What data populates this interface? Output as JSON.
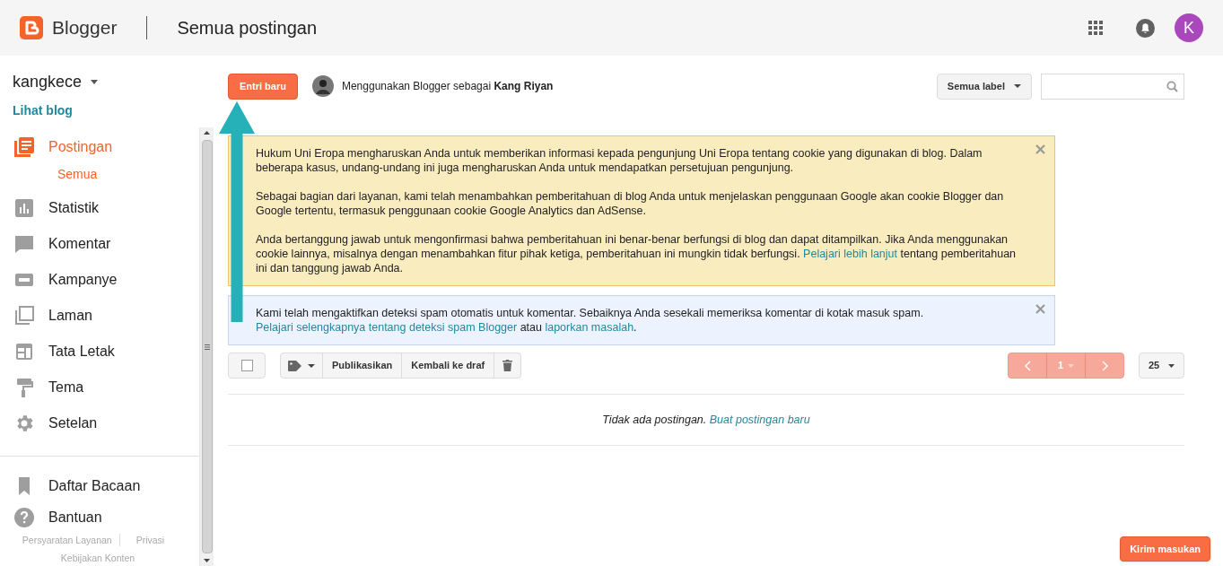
{
  "header": {
    "logo": "Blogger",
    "title": "Semua postingan",
    "avatar": "K"
  },
  "sidebar": {
    "blog": "kangkece",
    "view_blog": "Lihat blog",
    "items": [
      {
        "label": "Postingan",
        "selected": true,
        "children": [
          {
            "label": "Semua",
            "selected": true
          }
        ]
      },
      {
        "label": "Statistik",
        "selected": false
      },
      {
        "label": "Komentar",
        "selected": false
      },
      {
        "label": "Kampanye",
        "selected": false
      },
      {
        "label": "Laman",
        "selected": false
      },
      {
        "label": "Tata Letak",
        "selected": false
      },
      {
        "label": "Tema",
        "selected": false
      },
      {
        "label": "Setelan",
        "selected": false
      }
    ],
    "bottom_items": [
      {
        "label": "Daftar Bacaan"
      },
      {
        "label": "Bantuan"
      }
    ],
    "footer_links": [
      "Persyaratan Layanan",
      "Privasi",
      "Kebijakan Konten"
    ]
  },
  "toolbar": {
    "new_post": "Entri baru",
    "using_as": "Menggunakan Blogger sebagai **Kang Riyan**",
    "label_filter": "Semua label"
  },
  "notices": [
    {
      "kind": "warning",
      "paragraphs": [
        [
          {
            "text": "Hukum Uni Eropa mengharuskan Anda untuk memberikan informasi kepada pengunjung Uni Eropa tentang cookie yang digunakan di blog. Dalam beberapa kasus, undang-undang ini juga mengharuskan Anda untuk mendapatkan persetujuan pengunjung.",
            "kind": "text"
          }
        ],
        [
          {
            "text": "Sebagai bagian dari layanan, kami telah menambahkan pemberitahuan di blog Anda untuk menjelaskan penggunaan Google akan cookie Blogger dan Google tertentu, termasuk penggunaan cookie Google Analytics dan AdSense.",
            "kind": "text"
          }
        ],
        [
          {
            "text": "Anda bertanggung jawab untuk mengonfirmasi bahwa pemberitahuan ini benar-benar berfungsi di blog dan dapat ditampilkan. Jika Anda menggunakan cookie lainnya, misalnya dengan menambahkan fitur pihak ketiga, pemberitahuan ini mungkin tidak berfungsi. ",
            "kind": "text"
          },
          {
            "text": "Pelajari lebih lanjut",
            "kind": "link"
          },
          {
            "text": " tentang pemberitahuan ini dan tanggung jawab Anda.",
            "kind": "text"
          }
        ]
      ]
    },
    {
      "kind": "info",
      "paragraphs": [
        [
          {
            "text": "Kami telah mengaktifkan deteksi spam otomatis untuk komentar. Sebaiknya Anda sesekali memeriksa komentar di kotak masuk spam. ",
            "kind": "text"
          },
          {
            "text": "Pelajari selengkapnya tentang deteksi spam Blogger",
            "kind": "link"
          },
          {
            "text": " atau ",
            "kind": "text"
          },
          {
            "text": "laporkan masalah",
            "kind": "link"
          },
          {
            "text": ".",
            "kind": "text"
          }
        ]
      ]
    }
  ],
  "actions": {
    "select_all_checked": false,
    "buttons": [
      "Publikasikan",
      "Kembali ke draf"
    ],
    "page": "1",
    "per_page": "25"
  },
  "empty": {
    "text": "Tidak ada postingan. ",
    "link": "Buat postingan baru"
  },
  "feedback": "Kirim masukan"
}
